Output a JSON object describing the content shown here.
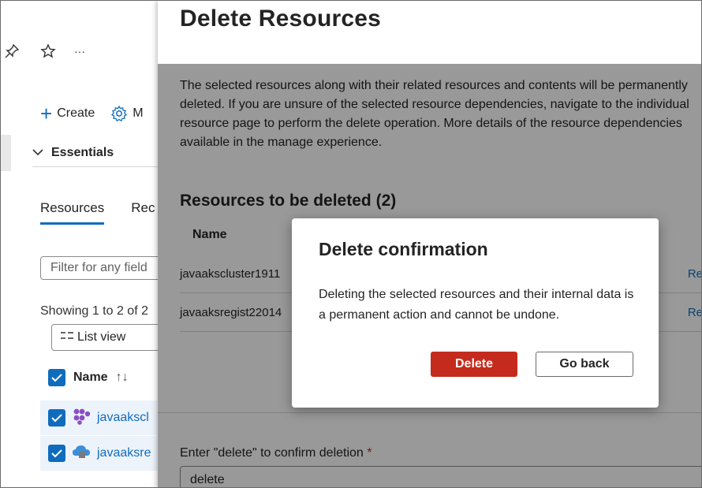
{
  "left": {
    "icons": [
      "pin-icon",
      "star-icon",
      "more-icon"
    ],
    "more_text": "···",
    "toolbar": {
      "create_label": "Create",
      "manage_label": "M"
    },
    "essentials_label": "Essentials",
    "tabs": [
      {
        "label": "Resources"
      },
      {
        "label": "Rec"
      }
    ],
    "filter_placeholder": "Filter for any field",
    "showing_text": "Showing 1 to 2 of 2",
    "list_view_label": "List view",
    "table_header": {
      "name_label": "Name",
      "sort_arrows": "↑↓"
    },
    "rows": [
      {
        "name": "javaakscl"
      },
      {
        "name": "javaaksre"
      }
    ]
  },
  "blade": {
    "title": "Delete Resources",
    "description": "The selected resources along with their related resources and contents will be permanently deleted. If you are unsure of the selected resource dependencies, navigate to the individual resource page to perform the delete operation. More details of the resource dependencies available in the manage experience.",
    "resources_title": "Resources to be deleted (2)",
    "column_name": "Name",
    "resources": [
      {
        "name": "javaakscluster1911",
        "link": "Re"
      },
      {
        "name": "javaaksregist22014",
        "link": "Re"
      }
    ],
    "confirm_label": "Enter \"delete\" to confirm deletion",
    "confirm_required": "*",
    "confirm_value": "delete"
  },
  "dialog": {
    "title": "Delete confirmation",
    "message": "Deleting the selected resources and their internal data is a permanent action and cannot be undone.",
    "delete_label": "Delete",
    "go_back_label": "Go back"
  },
  "colors": {
    "accent": "#0f6cbd",
    "danger": "#c42b1c"
  }
}
